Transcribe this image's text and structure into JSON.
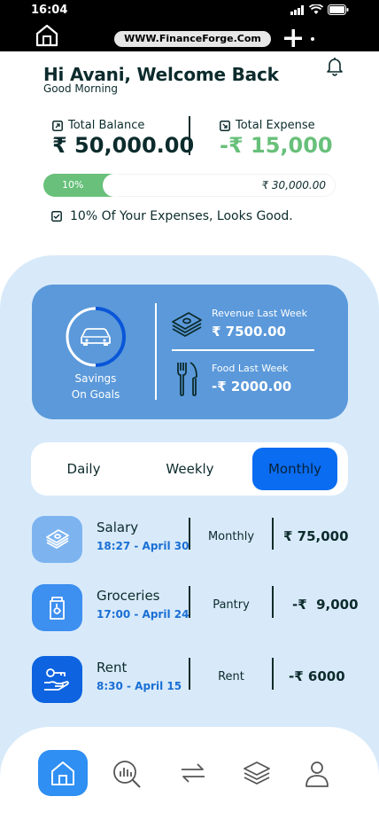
{
  "status_bar": {
    "time": "16:04"
  },
  "browser": {
    "url": "WWW.FinanceForge.Com"
  },
  "header": {
    "greeting": "Hi Avani, Welcome Back",
    "subtitle": "Good Morning"
  },
  "balance": {
    "total_balance_label": "Total Balance",
    "total_balance_value": "₹ 50,000.00",
    "total_expense_label": "Total Expense",
    "total_expense_value": "-₹ 15,000"
  },
  "budget_progress": {
    "percent_label": "10%",
    "percent": 10,
    "limit_value": "₹ 30,000.00",
    "message": "10% Of Your Expenses, Looks Good."
  },
  "summary_card": {
    "savings_label_line1": "Savings",
    "savings_label_line2": "On Goals",
    "revenue_label": "Revenue Last Week",
    "revenue_value": "₹ 7500.00",
    "food_label": "Food Last Week",
    "food_value": "-₹ 2000.00"
  },
  "period_tabs": {
    "daily": "Daily",
    "weekly": "Weekly",
    "monthly": "Monthly",
    "selected": "Monthly"
  },
  "transactions": [
    {
      "title": "Salary",
      "time": "18:27 - April 30",
      "category": "Monthly",
      "amount": "₹ 75,000",
      "icon": "money-stack-icon",
      "color": "#7db4f0"
    },
    {
      "title": "Groceries",
      "time": "17:00 - April 24",
      "category": "Pantry",
      "amount": "-₹  9,000",
      "icon": "grocery-bag-icon",
      "color": "#3d8ff0"
    },
    {
      "title": "Rent",
      "time": "8:30 - April 15",
      "category": "Rent",
      "amount": "-₹ 6000",
      "icon": "key-hand-icon",
      "color": "#0d63e0"
    }
  ],
  "bottom_nav": {
    "items": [
      "home-icon",
      "analysis-icon",
      "transactions-icon",
      "categories-icon",
      "profile-icon"
    ],
    "active": "home-icon"
  },
  "colors": {
    "accent": "#0a6cf0",
    "card": "#5b99da",
    "panel": "#d8eafa",
    "positive": "#68c07a"
  }
}
